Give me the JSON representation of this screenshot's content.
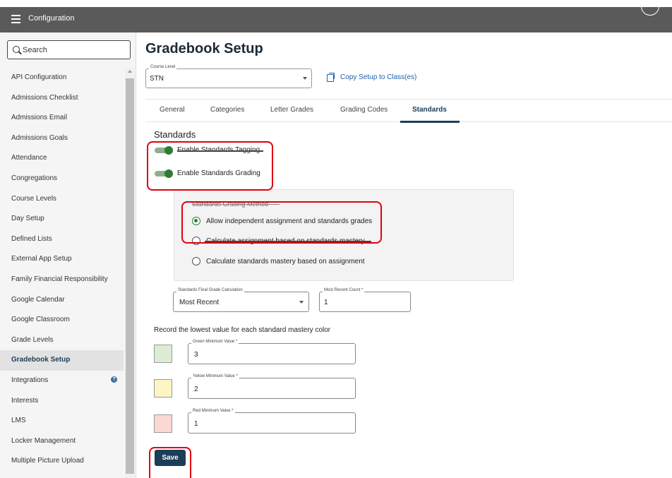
{
  "topbar": {
    "title": "Configuration"
  },
  "sidebar": {
    "search_placeholder": "Search",
    "items": [
      {
        "label": "API Configuration"
      },
      {
        "label": "Admissions Checklist"
      },
      {
        "label": "Admissions Email"
      },
      {
        "label": "Admissions Goals"
      },
      {
        "label": "Attendance"
      },
      {
        "label": "Congregations"
      },
      {
        "label": "Course Levels"
      },
      {
        "label": "Day Setup"
      },
      {
        "label": "Defined Lists"
      },
      {
        "label": "External App Setup"
      },
      {
        "label": "Family Financial Responsibility"
      },
      {
        "label": "Google Calendar"
      },
      {
        "label": "Google Classroom"
      },
      {
        "label": "Grade Levels"
      },
      {
        "label": "Gradebook Setup",
        "active": true
      },
      {
        "label": "Integrations",
        "badge": "?"
      },
      {
        "label": "Interests"
      },
      {
        "label": "LMS"
      },
      {
        "label": "Locker Management"
      },
      {
        "label": "Multiple Picture Upload"
      }
    ]
  },
  "main": {
    "title": "Gradebook Setup",
    "course_level": {
      "label": "Course Level",
      "value": "STN"
    },
    "copy_link": "Copy Setup to Class(es)",
    "tabs": [
      "General",
      "Categories",
      "Letter Grades",
      "Grading Codes",
      "Standards"
    ],
    "active_tab": "Standards",
    "section_title": "Standards",
    "toggles": [
      {
        "label": "Enable Standards Tagging",
        "on": true
      },
      {
        "label": "Enable Standards Grading",
        "on": true
      }
    ],
    "method": {
      "title": "Standards Grading Method",
      "options": [
        {
          "label": "Allow independent assignment and standards grades",
          "selected": true
        },
        {
          "label": "Calculate assignment based on standards mastery",
          "selected": false
        },
        {
          "label": "Calculate standards mastery based on assignment",
          "selected": false
        }
      ]
    },
    "final_grade": {
      "label": "Standards Final Grade Calculation",
      "value": "Most Recent"
    },
    "recent_count": {
      "label": "Most Recent Count *",
      "value": "1"
    },
    "mastery_title": "Record the lowest value for each standard mastery color",
    "mastery": [
      {
        "label": "Green Minimum Value *",
        "value": "3",
        "color": "#dcecd6"
      },
      {
        "label": "Yellow Minimum Value *",
        "value": "2",
        "color": "#fdf5c4"
      },
      {
        "label": "Red Minimum Value *",
        "value": "1",
        "color": "#fbd9d3"
      }
    ],
    "save_label": "Save"
  },
  "colors": {
    "primary": "#1c3d57",
    "accent_green": "#2e7d32",
    "link": "#1f5fa8",
    "highlight": "#e0000f"
  }
}
